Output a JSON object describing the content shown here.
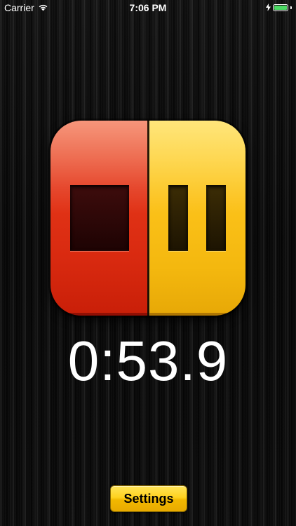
{
  "status_bar": {
    "carrier": "Carrier",
    "time": "7:06 PM",
    "wifi_icon": "wifi-icon",
    "battery_icon": "battery-icon",
    "battery_color": "#4cd964"
  },
  "control": {
    "stop_color": "#e33518",
    "pause_color": "#fcc21a",
    "stop_icon": "stop-icon",
    "pause_icon": "pause-icon"
  },
  "timer": {
    "value": "0:53.9"
  },
  "settings": {
    "label": "Settings",
    "color": "#ffd21f"
  }
}
